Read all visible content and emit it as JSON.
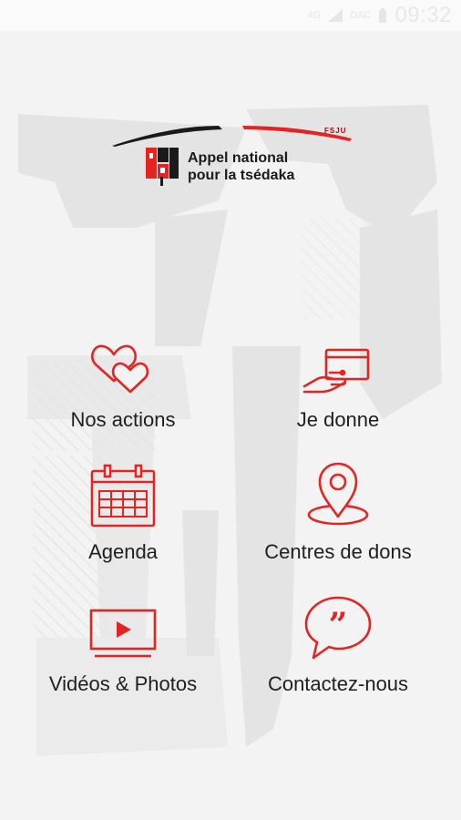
{
  "status_bar": {
    "network_label": "4G",
    "carrier": "DAC",
    "time": "09:32"
  },
  "logo": {
    "line1": "Appel national",
    "line2": "pour la tsédaka",
    "tag": "FSJU"
  },
  "menu": {
    "items": [
      {
        "label": "Nos actions",
        "icon": "hearts-icon"
      },
      {
        "label": "Je donne",
        "icon": "card-payment-icon"
      },
      {
        "label": "Agenda",
        "icon": "calendar-icon"
      },
      {
        "label": "Centres de dons",
        "icon": "map-pin-icon"
      },
      {
        "label": "Vidéos & Photos",
        "icon": "video-player-icon"
      },
      {
        "label": "Contactez-nous",
        "icon": "speech-bubble-icon"
      }
    ]
  },
  "colors": {
    "accent": "#e52421",
    "background": "#f3f3f3",
    "watermark": "#e4e4e4",
    "text": "#202020"
  }
}
